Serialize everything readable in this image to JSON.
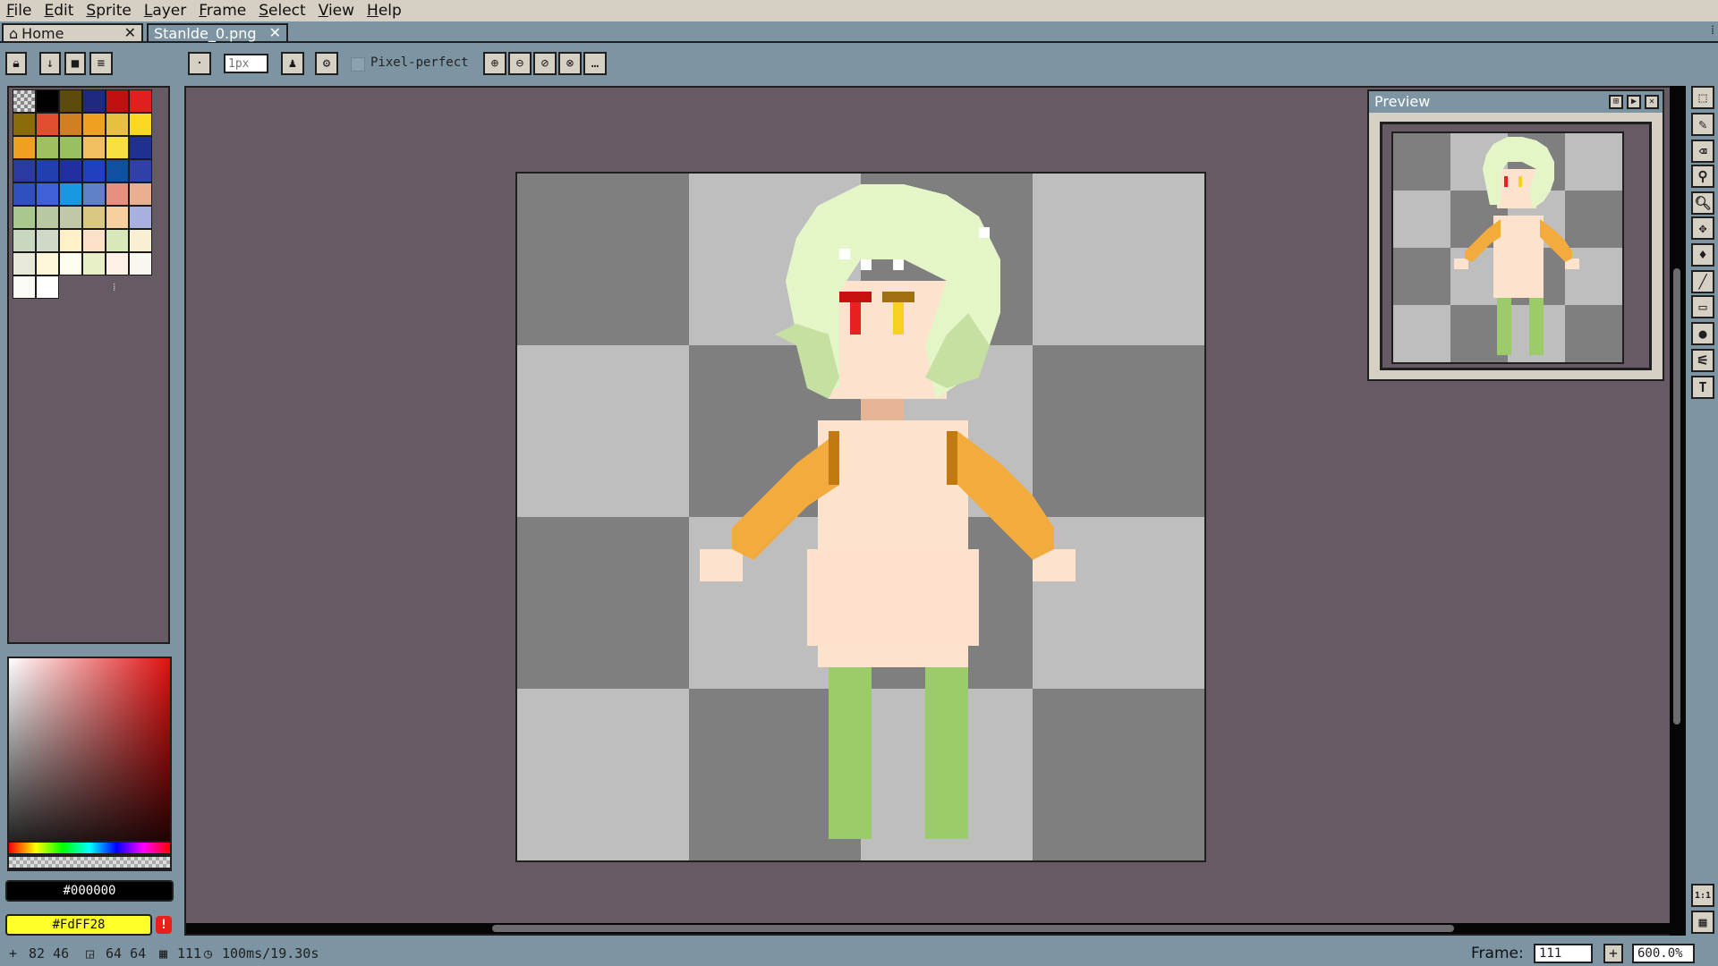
{
  "menu": [
    "File",
    "Edit",
    "Sprite",
    "Layer",
    "Frame",
    "Select",
    "View",
    "Help"
  ],
  "tabs": {
    "home": "Home",
    "file": "Stanlde_0.png",
    "close": "✕"
  },
  "toolbar": {
    "brush_size_placeholder": "1px",
    "pixel_perfect_label": "Pixel-perfect",
    "more_label": "…"
  },
  "colors": {
    "foreground_hex": "#000000",
    "background_hex": "#FdFF28",
    "background_swatch": "#fdff28",
    "accent": "#7d94a3",
    "panel": "#d6cfc3",
    "editor_bg": "#665a65"
  },
  "palette": [
    "#000000",
    "#5c4b0c",
    "#1d2a80",
    "#c01010",
    "#e02020",
    "#8a6a0a",
    "#e05030",
    "#d08020",
    "#f0a020",
    "#e8c040",
    "#f8d820",
    "#f0a020",
    "#a0c060",
    "#98c060",
    "#f0c060",
    "#f8e040",
    "#203090",
    "#2a3aa0",
    "#2040b0",
    "#2030a0",
    "#2040c0",
    "#1050a0",
    "#3040a8",
    "#3050c0",
    "#4060d8",
    "#1898e0",
    "#6080c8",
    "#e89080",
    "#e8b090",
    "#a8c890",
    "#b8c8a0",
    "#c0c8a8",
    "#d8c880",
    "#f8d0a0",
    "#a8b0e0",
    "#c8d8c0",
    "#d0d8c8",
    "#fff0c8",
    "#fde0c8",
    "#d8e8b8",
    "#f8f0d0",
    "#e8e8d8",
    "#fff8d8",
    "#fffcf0",
    "#e8f0c8",
    "#fff0e8",
    "#f8f8f0",
    "#fbfbf5",
    "#ffffff"
  ],
  "preview": {
    "title": "Preview"
  },
  "status": {
    "cursor": "82 46",
    "size": "64 64",
    "frame": "111",
    "duration": "100ms/19.30s",
    "frame_label": "Frame:",
    "frame_value": "111",
    "zoom": "600.0%"
  },
  "right_tools": {
    "one_to_one": "1:1",
    "text_tool": "T"
  }
}
